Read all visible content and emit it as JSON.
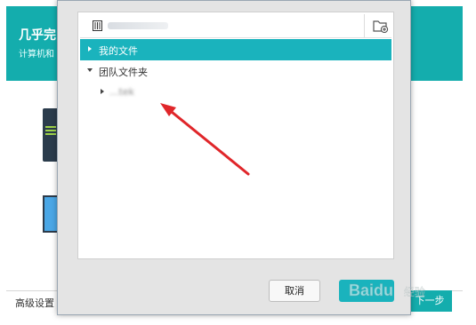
{
  "background_app": {
    "title": "几乎完",
    "subtitle": "计算机和",
    "advanced_settings": "高级设置",
    "next_button": "下一步",
    "accent_color": "#14adad"
  },
  "dialog": {
    "path": {
      "icon": "drive-icon",
      "text": "",
      "new_folder_icon": "new-folder-icon"
    },
    "tree": [
      {
        "label": "我的文件",
        "expanded": false,
        "selected": true
      },
      {
        "label": "团队文件夹",
        "expanded": true,
        "selected": false
      },
      {
        "label": "",
        "expanded": false,
        "selected": false,
        "blurred_label": "...tek"
      }
    ],
    "buttons": {
      "cancel": "取消",
      "ok": ""
    },
    "selection_color": "#1ab3bd"
  },
  "annotation": {
    "arrow_color": "#e0262a"
  },
  "watermark": {
    "brand": "Baidu",
    "subtext": "经验"
  }
}
